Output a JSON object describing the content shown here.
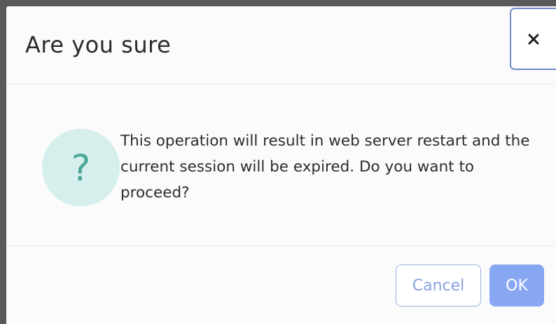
{
  "dialog": {
    "title": "Are you sure",
    "close_icon": "close-icon",
    "question_icon": "?",
    "message": "This operation will result in web server restart and the current session will be expired. Do you want to proceed?"
  },
  "buttons": {
    "cancel_label": "Cancel",
    "ok_label": "OK"
  },
  "colors": {
    "accent": "#88a7f3",
    "icon_circle": "#d6efec",
    "icon_mark": "#49a798",
    "close_border": "#6f8bc6"
  }
}
